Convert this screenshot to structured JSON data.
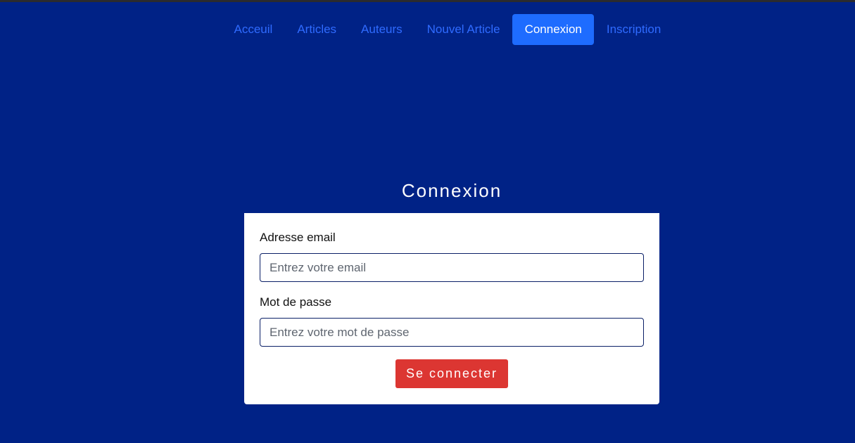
{
  "nav": {
    "items": [
      {
        "label": "Acceuil",
        "active": false
      },
      {
        "label": "Articles",
        "active": false
      },
      {
        "label": "Auteurs",
        "active": false
      },
      {
        "label": "Nouvel Article",
        "active": false
      },
      {
        "label": "Connexion",
        "active": true
      },
      {
        "label": "Inscription",
        "active": false
      }
    ]
  },
  "page": {
    "title": "Connexion"
  },
  "form": {
    "email": {
      "label": "Adresse email",
      "placeholder": "Entrez votre email",
      "value": ""
    },
    "password": {
      "label": "Mot de passe",
      "placeholder": "Entrez votre mot de passe",
      "value": ""
    },
    "submit_label": "Se connecter"
  },
  "colors": {
    "background": "#002286",
    "nav_link": "#2f6bff",
    "nav_active_bg": "#1e6cff",
    "submit_bg": "#dc3632",
    "card_bg": "#ffffff"
  }
}
